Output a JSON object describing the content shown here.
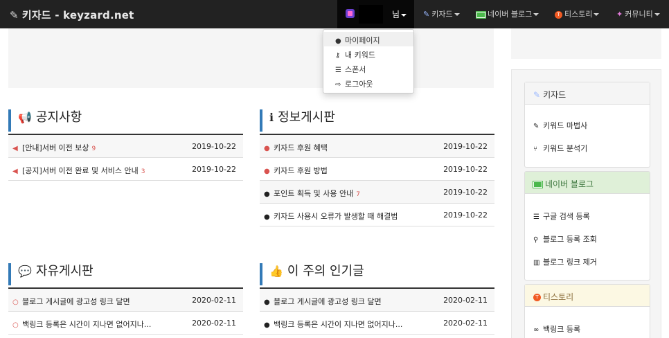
{
  "brand": {
    "title": "키자드 - keyzard.net",
    "icon": "magic-wand-icon"
  },
  "navbar": {
    "user_suffix": "님",
    "menus": [
      {
        "label": "키자드",
        "icon": "magic-wand-icon"
      },
      {
        "label": "네이버 블로그",
        "icon": "naver-blog-icon"
      },
      {
        "label": "티스토리",
        "icon": "tistory-icon"
      },
      {
        "label": "커뮤니티",
        "icon": "community-icon"
      }
    ]
  },
  "user_menu": {
    "items": [
      {
        "label": "마이페이지",
        "icon": "user-icon"
      },
      {
        "label": "내 키워드",
        "icon": "key-icon"
      },
      {
        "label": "스폰서",
        "icon": "coins-icon"
      },
      {
        "label": "로그아웃",
        "icon": "sign-out-icon"
      }
    ]
  },
  "boards": {
    "notice": {
      "title": "공지사항",
      "icon": "megaphone-icon",
      "rows": [
        {
          "title": "[안내]서버 이전 보상",
          "count": "9",
          "date": "2019-10-22"
        },
        {
          "title": "[공지]서버 이전 완료 및 서비스 안내",
          "count": "3",
          "date": "2019-10-22"
        }
      ]
    },
    "info": {
      "title": "정보게시판",
      "icon": "info-circle-icon",
      "rows": [
        {
          "title": "키자드 후원 혜택",
          "count": "",
          "date": "2019-10-22"
        },
        {
          "title": "키자드 후원 방법",
          "count": "",
          "date": "2019-10-22"
        },
        {
          "title": "포인트 획득 및 사용 안내",
          "count": "7",
          "date": "2019-10-22"
        },
        {
          "title": "키자드 사용시 오류가 발생할 때 해결법",
          "count": "",
          "date": "2019-10-22"
        }
      ]
    },
    "free": {
      "title": "자유게시판",
      "icon": "comments-icon",
      "rows": [
        {
          "title": "블로그 게시글에 광고성 링크 달면",
          "date": "2020-02-11"
        },
        {
          "title": "백링크 등록은 시간이 지나면 없어지나...",
          "date": "2020-02-11"
        }
      ]
    },
    "popular": {
      "title": "이 주의 인기글",
      "icon": "thumbs-up-icon",
      "rows": [
        {
          "title": "블로그 게시글에 광고성 링크 달면",
          "date": "2020-02-11"
        },
        {
          "title": "백링크 등록은 시간이 지나면 없어지나...",
          "date": "2020-02-11"
        }
      ]
    }
  },
  "sidebar": {
    "keyzard": {
      "title": "키자드",
      "links": [
        {
          "label": "키워드 마법사",
          "icon": "magic-wand-icon"
        },
        {
          "label": "키워드 분석기",
          "icon": "code-fork-icon"
        }
      ]
    },
    "naver": {
      "title": "네이버 블로그",
      "links": [
        {
          "label": "구글 검색 등록",
          "icon": "database-icon"
        },
        {
          "label": "블로그 등록 조회",
          "icon": "search-icon"
        },
        {
          "label": "블로그 링크 제거",
          "icon": "trash-icon"
        }
      ]
    },
    "tistory": {
      "title": "티스토리",
      "links": [
        {
          "label": "백링크 등록",
          "icon": "link-icon"
        }
      ]
    }
  },
  "colors": {
    "navbar_bg": "#222222",
    "accent_blue": "#337ab7",
    "count_red": "#d9534f",
    "naver_green": "#dff0d8",
    "tistory_yellow": "#fcf8e3"
  }
}
